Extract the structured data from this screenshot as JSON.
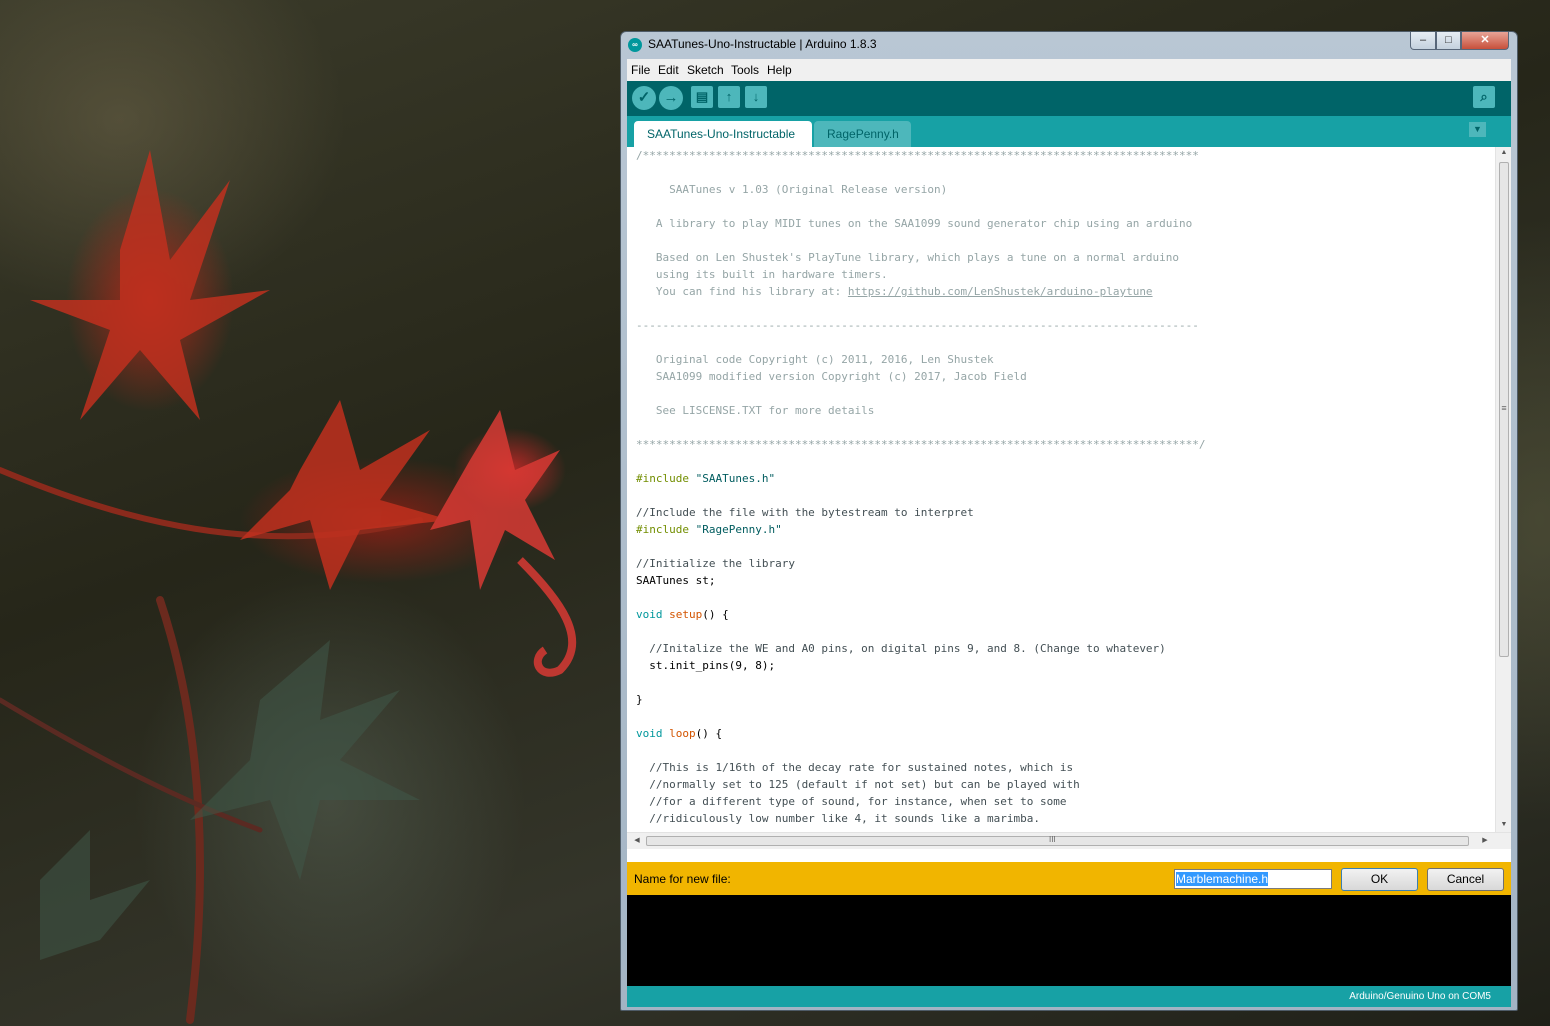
{
  "window": {
    "title": "SAATunes-Uno-Instructable | Arduino 1.8.3",
    "icon": "arduino-logo-icon",
    "controls": {
      "minimize": "‒",
      "maximize": "□",
      "close": "✕"
    }
  },
  "menu": [
    "File",
    "Edit",
    "Sketch",
    "Tools",
    "Help"
  ],
  "toolbar": {
    "verify_icon": "✓",
    "upload_icon": "→",
    "new_icon": "▤",
    "open_icon": "↑",
    "save_icon": "↓",
    "serial_monitor_icon": "⌕"
  },
  "tabs": [
    "SAATunes-Uno-Instructable",
    "RagePenny.h"
  ],
  "tab_menu_icon": "▼",
  "code": [
    "/************************************************************************************",
    "",
    "     SAATunes v 1.03 (Original Release version)",
    "",
    "   A library to play MIDI tunes on the SAA1099 sound generator chip using an arduino",
    "",
    "   Based on Len Shustek's PlayTune library, which plays a tune on a normal arduino",
    "   using its built in hardware timers.",
    "   You can find his library at: ",
    "",
    "-------------------------------------------------------------------------------------",
    "",
    "   Original code Copyright (c) 2011, 2016, Len Shustek",
    "   SAA1099 modified version Copyright (c) 2017, Jacob Field",
    "",
    "   See LISCENSE.TXT for more details",
    "",
    "*************************************************************************************/",
    "",
    "",
    "",
    "//Include the file with the bytestream to interpret",
    "",
    "",
    "//Initialize the library",
    "SAATunes st;",
    "",
    "",
    "",
    "  //Initalize the WE and A0 pins, on digital pins 9, and 8. (Change to whatever)",
    "  st.init_pins(9, 8);",
    "",
    "}",
    "",
    "",
    "",
    "  //This is 1/16th of the decay rate for sustained notes, which is",
    "  //normally set to 125 (default if not set) but can be played with",
    "  //for a different type of sound, for instance, when set to some",
    "  //ridiculously low number like 4, it sounds like a marimba."
  ],
  "code_tokens": {
    "url": "https://github.com/LenShustek/arduino-playtune",
    "include_kw": "#include",
    "include_1": "\"SAATunes.h\"",
    "include_2": "\"RagePenny.h\"",
    "void_kw": "void",
    "setup_fn": "setup",
    "setup_rest": "() {",
    "loop_fn": "loop",
    "loop_rest": "() {"
  },
  "vscroll_grip": "≡",
  "hscroll_grip": "III",
  "new_file_prompt": {
    "label": "Name for new file:",
    "value": "Marblemachine.h",
    "ok": "OK",
    "cancel": "Cancel"
  },
  "status": "Arduino/Genuino Uno on COM5",
  "colors": {
    "toolbar": "#006468",
    "tabbar": "#17a1a5",
    "notice_bar": "#f1b500",
    "console": "#000000"
  }
}
